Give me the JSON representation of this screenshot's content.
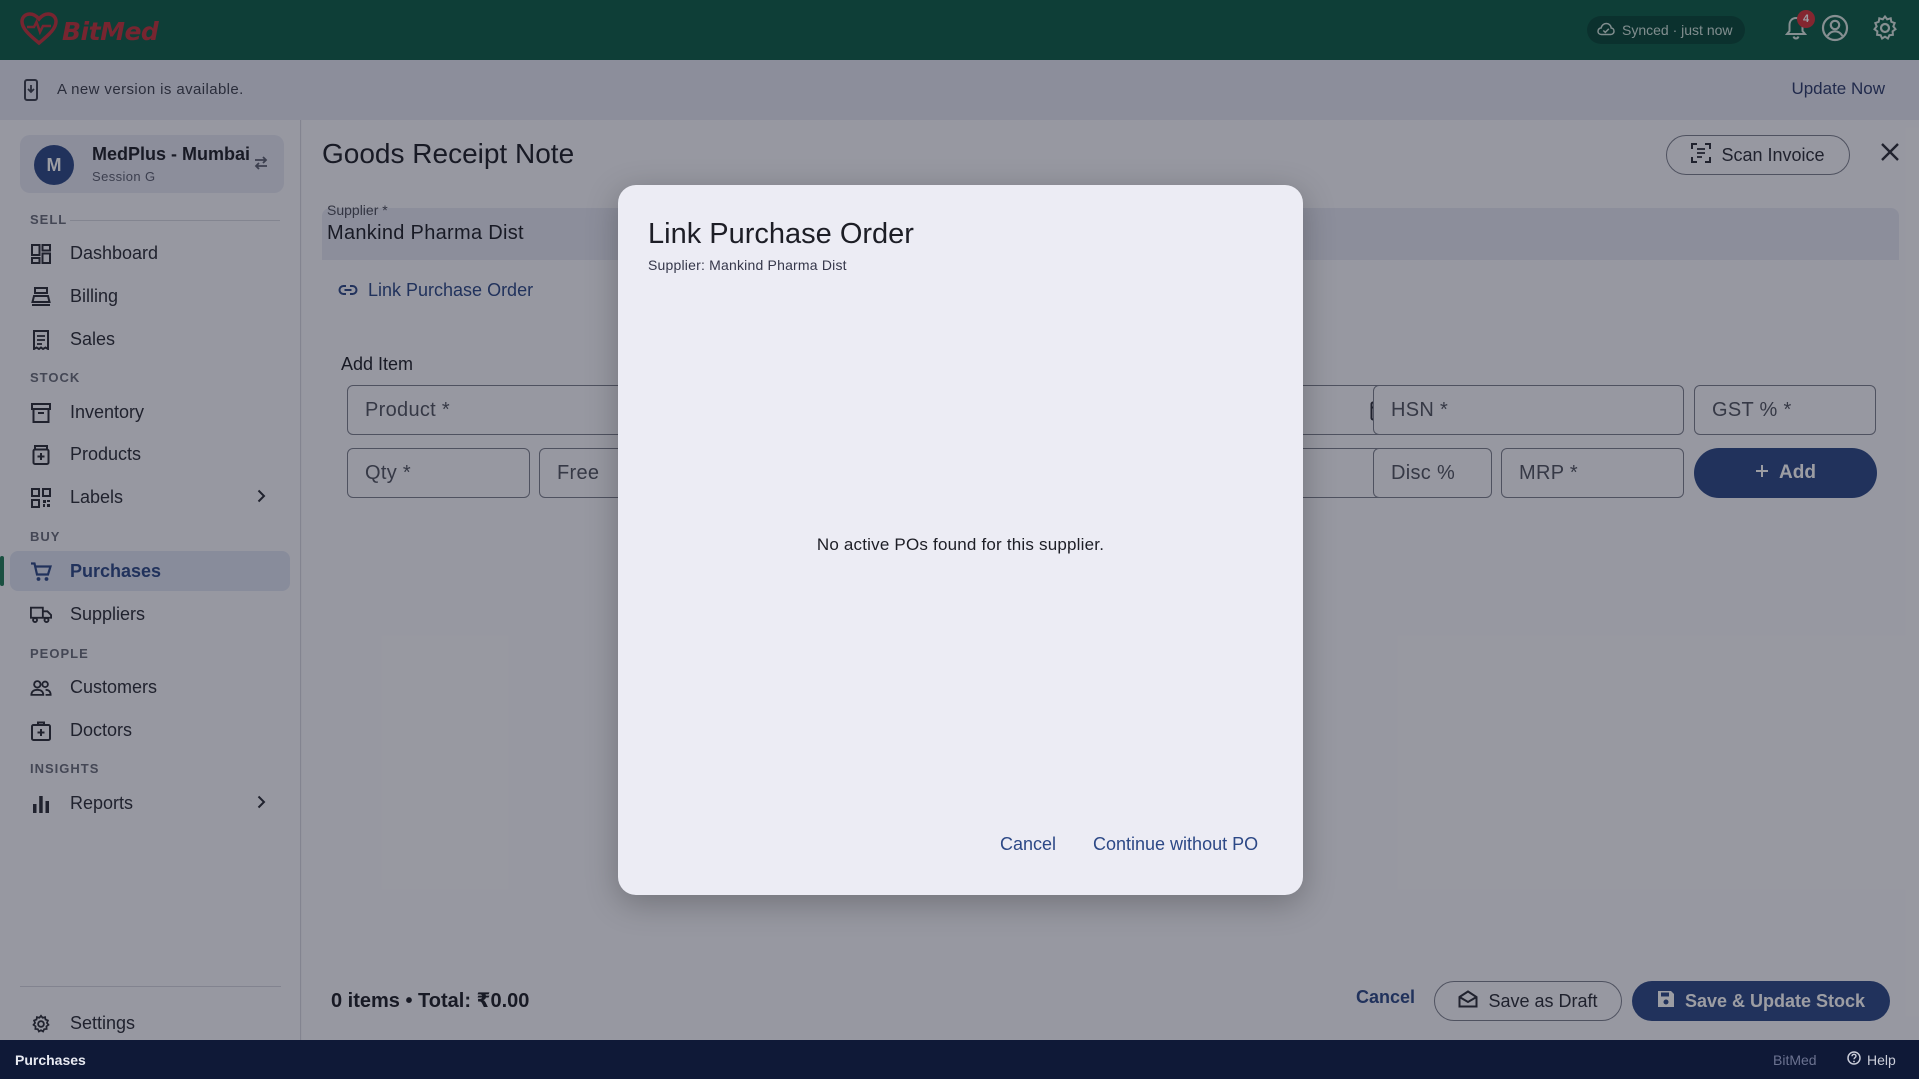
{
  "app": {
    "name": "BitMed"
  },
  "topbar": {
    "sync_status": "Synced · just now",
    "notification_count": "4"
  },
  "banner": {
    "message": "A new version is available.",
    "action": "Update Now"
  },
  "store": {
    "initial": "M",
    "name": "MedPlus - Mumbai",
    "session": "Session G"
  },
  "sidebar": {
    "sections": {
      "sell": "SELL",
      "stock": "STOCK",
      "buy": "BUY",
      "people": "PEOPLE",
      "insights": "INSIGHTS"
    },
    "items": {
      "dashboard": "Dashboard",
      "billing": "Billing",
      "sales": "Sales",
      "inventory": "Inventory",
      "products": "Products",
      "labels": "Labels",
      "purchases": "Purchases",
      "suppliers": "Suppliers",
      "customers": "Customers",
      "doctors": "Doctors",
      "reports": "Reports",
      "settings": "Settings"
    },
    "active_item": "purchases"
  },
  "page": {
    "title": "Goods Receipt Note",
    "scan_invoice": "Scan Invoice",
    "supplier_label": "Supplier *",
    "supplier_value": "Mankind Pharma Dist",
    "link_po": "Link Purchase Order",
    "add_item_label": "Add Item",
    "fields": {
      "product": "Product *",
      "hsn": "HSN *",
      "gst": "GST % *",
      "qty": "Qty *",
      "free": "Free",
      "disc": "Disc %",
      "mrp": "MRP *"
    },
    "add_button": "Add",
    "totals": "0 items • Total: ₹0.00",
    "cancel": "Cancel",
    "save_draft": "Save as Draft",
    "save_update": "Save & Update Stock"
  },
  "dialog": {
    "title": "Link Purchase Order",
    "subtitle": "Supplier: Mankind Pharma Dist",
    "empty_message": "No active POs found for this supplier.",
    "cancel": "Cancel",
    "continue": "Continue without PO"
  },
  "statusbar": {
    "left": "Purchases",
    "brand": "BitMed",
    "help": "Help"
  },
  "colors": {
    "primary": "#2c4886",
    "topbar": "#0c5c46",
    "active_indicator": "#1f7a57",
    "statusbar": "#0f1937",
    "badge": "#d6323a"
  }
}
